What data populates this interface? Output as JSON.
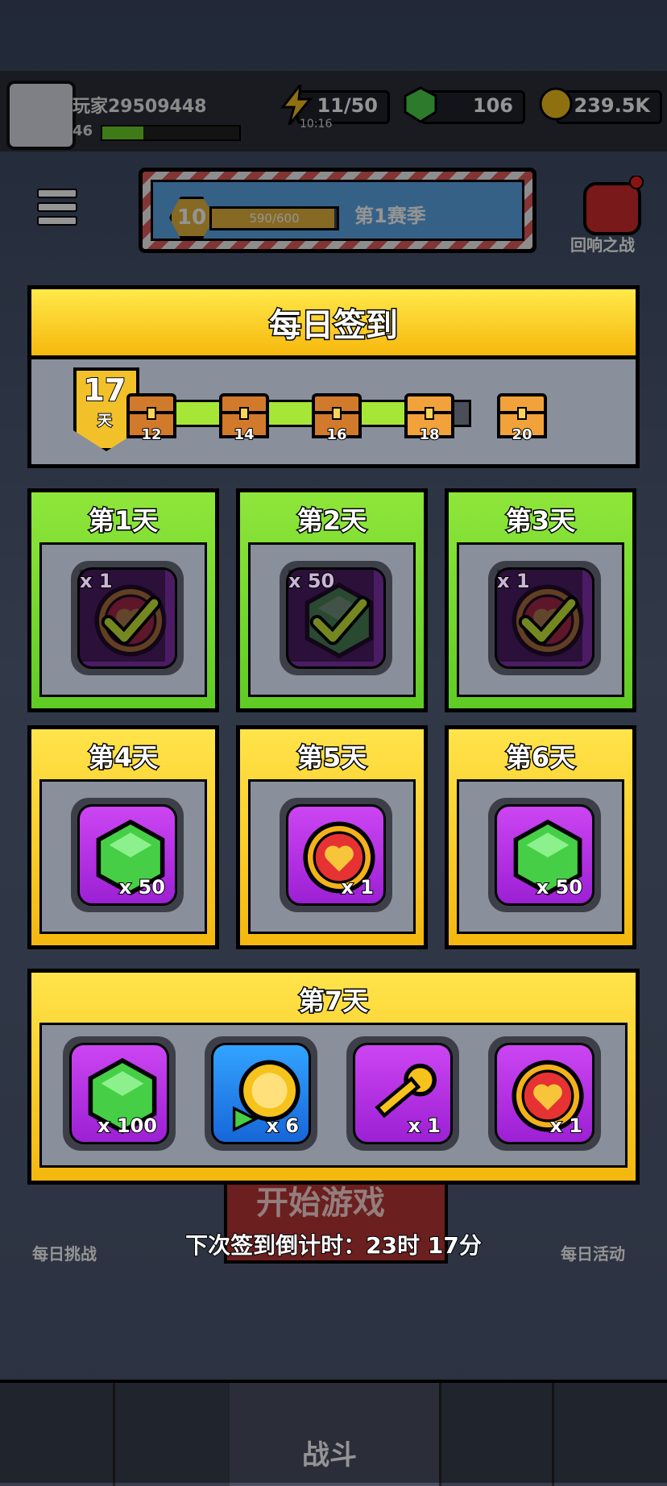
{
  "hud": {
    "player_name": "玩家29509448",
    "player_level": "46",
    "energy": "11/50",
    "energy_timer": "10:16",
    "gems": "106",
    "coins": "239.5K"
  },
  "season": {
    "level": "10",
    "progress_text": "590/600",
    "progress_fraction": 0.98,
    "name": "第1赛季"
  },
  "event_button_label": "回响之战",
  "background_buttons": {
    "daily_challenge": "每日挑战",
    "start_game": "开始游戏",
    "daily_activity": "每日活动",
    "fight": "战斗"
  },
  "signin": {
    "title": "每日签到",
    "current_day": "17",
    "day_unit": "天",
    "track_fill_fraction": 0.94,
    "milestones": [
      {
        "label": "12",
        "claimed": true
      },
      {
        "label": "14",
        "claimed": true
      },
      {
        "label": "16",
        "claimed": true
      },
      {
        "label": "18",
        "claimed": false
      },
      {
        "label": "20",
        "claimed": false
      }
    ],
    "days": [
      {
        "title": "第1天",
        "item": "heart-token-icon",
        "qty": "x 1",
        "claimed": true
      },
      {
        "title": "第2天",
        "item": "gem-icon",
        "qty": "x 50",
        "claimed": true
      },
      {
        "title": "第3天",
        "item": "heart-token-icon",
        "qty": "x 1",
        "claimed": true
      },
      {
        "title": "第4天",
        "item": "gem-icon",
        "qty": "x 50",
        "claimed": false
      },
      {
        "title": "第5天",
        "item": "heart-token-icon",
        "qty": "x 1",
        "claimed": false
      },
      {
        "title": "第6天",
        "item": "gem-icon",
        "qty": "x 50",
        "claimed": false
      }
    ],
    "day7": {
      "title": "第7天",
      "rewards": [
        {
          "item": "gem-icon",
          "qty": "x 100"
        },
        {
          "item": "coin-video-icon",
          "qty": "x 6"
        },
        {
          "item": "key-icon",
          "qty": "x 1"
        },
        {
          "item": "heart-token-icon",
          "qty": "x 1"
        }
      ]
    },
    "countdown": "下次签到倒计时：23时 17分"
  },
  "colors": {
    "claimed_card": "#6fd62d",
    "pending_card": "#f6c21c",
    "item_purple": "#b233e6"
  }
}
